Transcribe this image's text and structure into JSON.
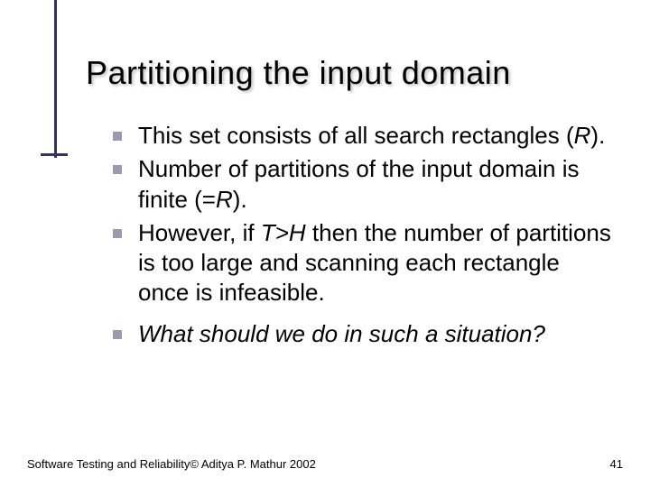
{
  "slide": {
    "title": "Partitioning the input domain",
    "bullets": [
      {
        "segments": [
          {
            "text": "This set consists of all search rectangles (",
            "style": "normal"
          },
          {
            "text": "R",
            "style": "italic"
          },
          {
            "text": ").",
            "style": "normal"
          }
        ]
      },
      {
        "segments": [
          {
            "text": "Number of partitions of the input domain is finite (=",
            "style": "normal"
          },
          {
            "text": "R",
            "style": "italic"
          },
          {
            "text": ").",
            "style": "normal"
          }
        ]
      },
      {
        "segments": [
          {
            "text": "However, if ",
            "style": "normal"
          },
          {
            "text": "T>H",
            "style": "italic"
          },
          {
            "text": " then the number of partitions is too large and scanning each rectangle once is infeasible.",
            "style": "normal"
          }
        ]
      },
      {
        "gap_before": true,
        "segments": [
          {
            "text": "What should we do in such a situation?",
            "style": "italic"
          }
        ]
      }
    ],
    "footer_left": "Software Testing and Reliability© Aditya P. Mathur 2002",
    "footer_right": "41"
  },
  "colors": {
    "accent": "#333366",
    "bullet": "#9999b3"
  }
}
